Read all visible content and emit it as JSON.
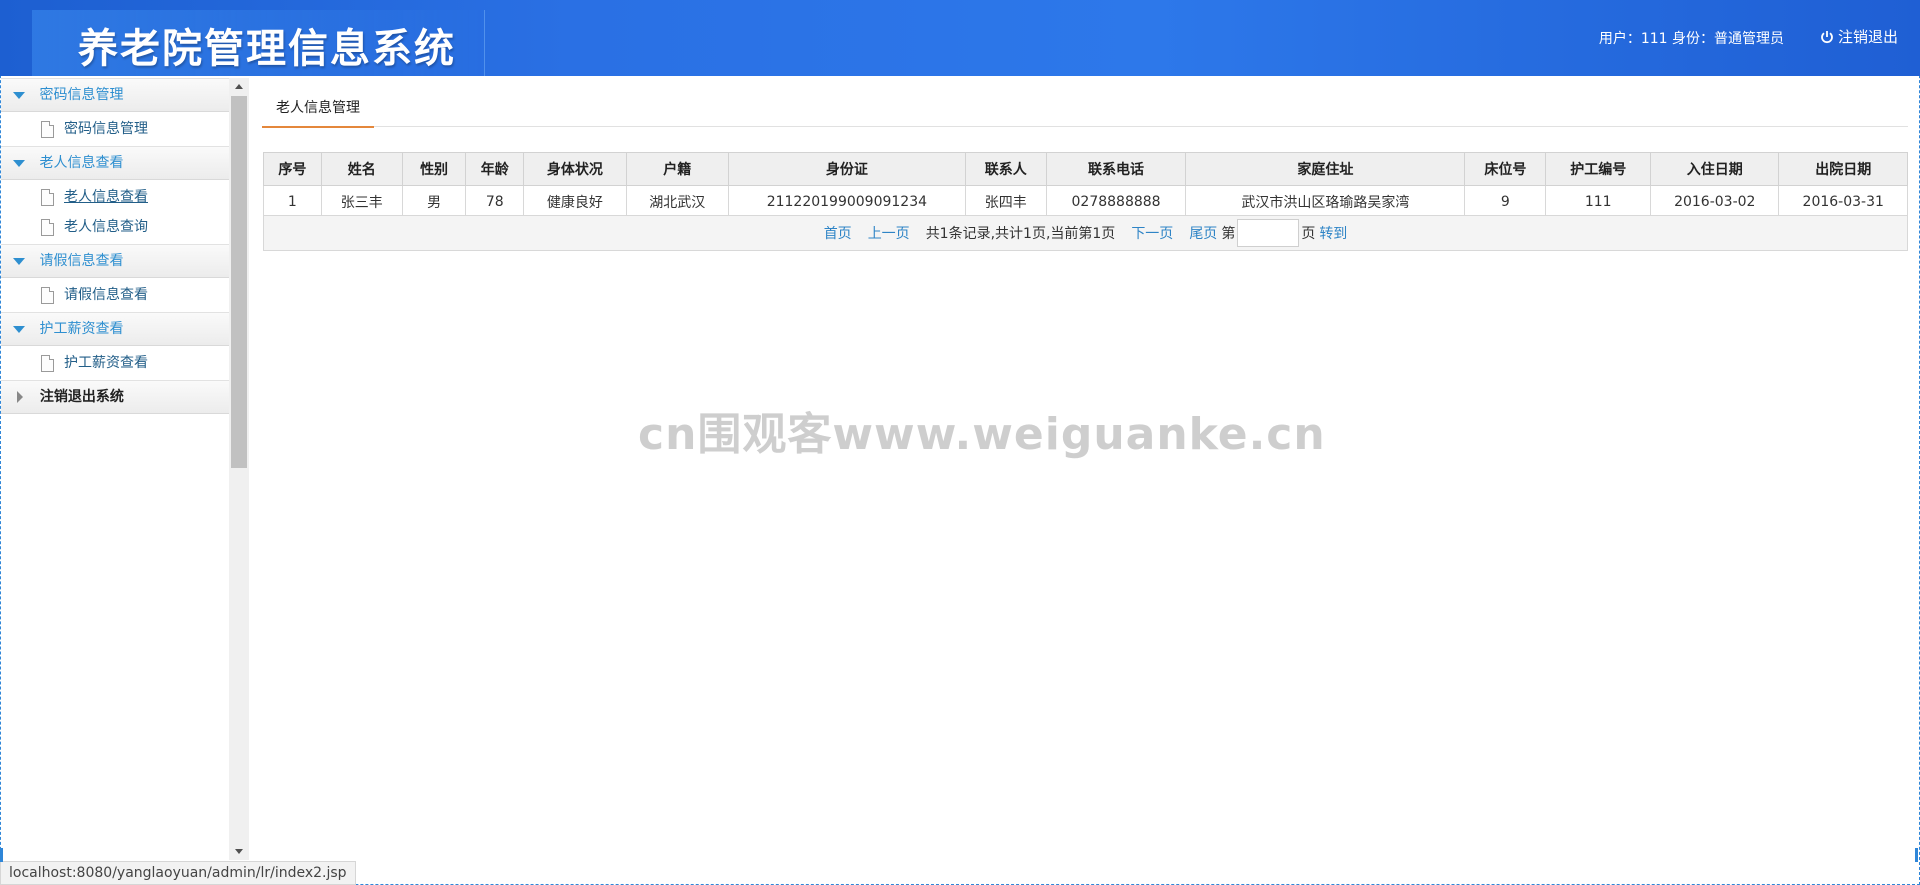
{
  "header": {
    "title": "养老院管理信息系统",
    "user_info": "用户：111 身份：普通管理员",
    "logout_label": "注销退出"
  },
  "sidebar": {
    "groups": [
      {
        "label": "密码信息管理",
        "items": [
          {
            "label": "密码信息管理"
          }
        ]
      },
      {
        "label": "老人信息查看",
        "items": [
          {
            "label": "老人信息查看"
          },
          {
            "label": "老人信息查询"
          }
        ]
      },
      {
        "label": "请假信息查看",
        "items": [
          {
            "label": "请假信息查看"
          }
        ]
      },
      {
        "label": "护工薪资查看",
        "items": [
          {
            "label": "护工薪资查看"
          }
        ]
      }
    ],
    "logout_group": "注销退出系统"
  },
  "main": {
    "tab_label": "老人信息管理",
    "table": {
      "headers": [
        "序号",
        "姓名",
        "性别",
        "年龄",
        "身体状况",
        "户籍",
        "身份证",
        "联系人",
        "联系电话",
        "家庭住址",
        "床位号",
        "护工编号",
        "入住日期",
        "出院日期"
      ],
      "rows": [
        [
          "1",
          "张三丰",
          "男",
          "78",
          "健康良好",
          "湖北武汉",
          "211220199009091234",
          "张四丰",
          "0278888888",
          "武汉市洪山区珞瑜路吴家湾",
          "9",
          "111",
          "2016-03-02",
          "2016-03-31"
        ]
      ]
    },
    "pager": {
      "first": "首页",
      "prev": "上一页",
      "summary": "共1条记录,共计1页,当前第1页",
      "next": "下一页",
      "last": "尾页",
      "page_prefix": "第",
      "page_input_value": "",
      "page_suffix": "页",
      "go": "转到"
    }
  },
  "watermark": "cn围观客www.weiguanke.cn",
  "status_url": "localhost:8080/yanglaoyuan/admin/lr/index2.jsp",
  "colors": {
    "header_blue": "#2a70e4",
    "menu_link": "#2e8fd0",
    "tab_accent": "#e4873b"
  }
}
